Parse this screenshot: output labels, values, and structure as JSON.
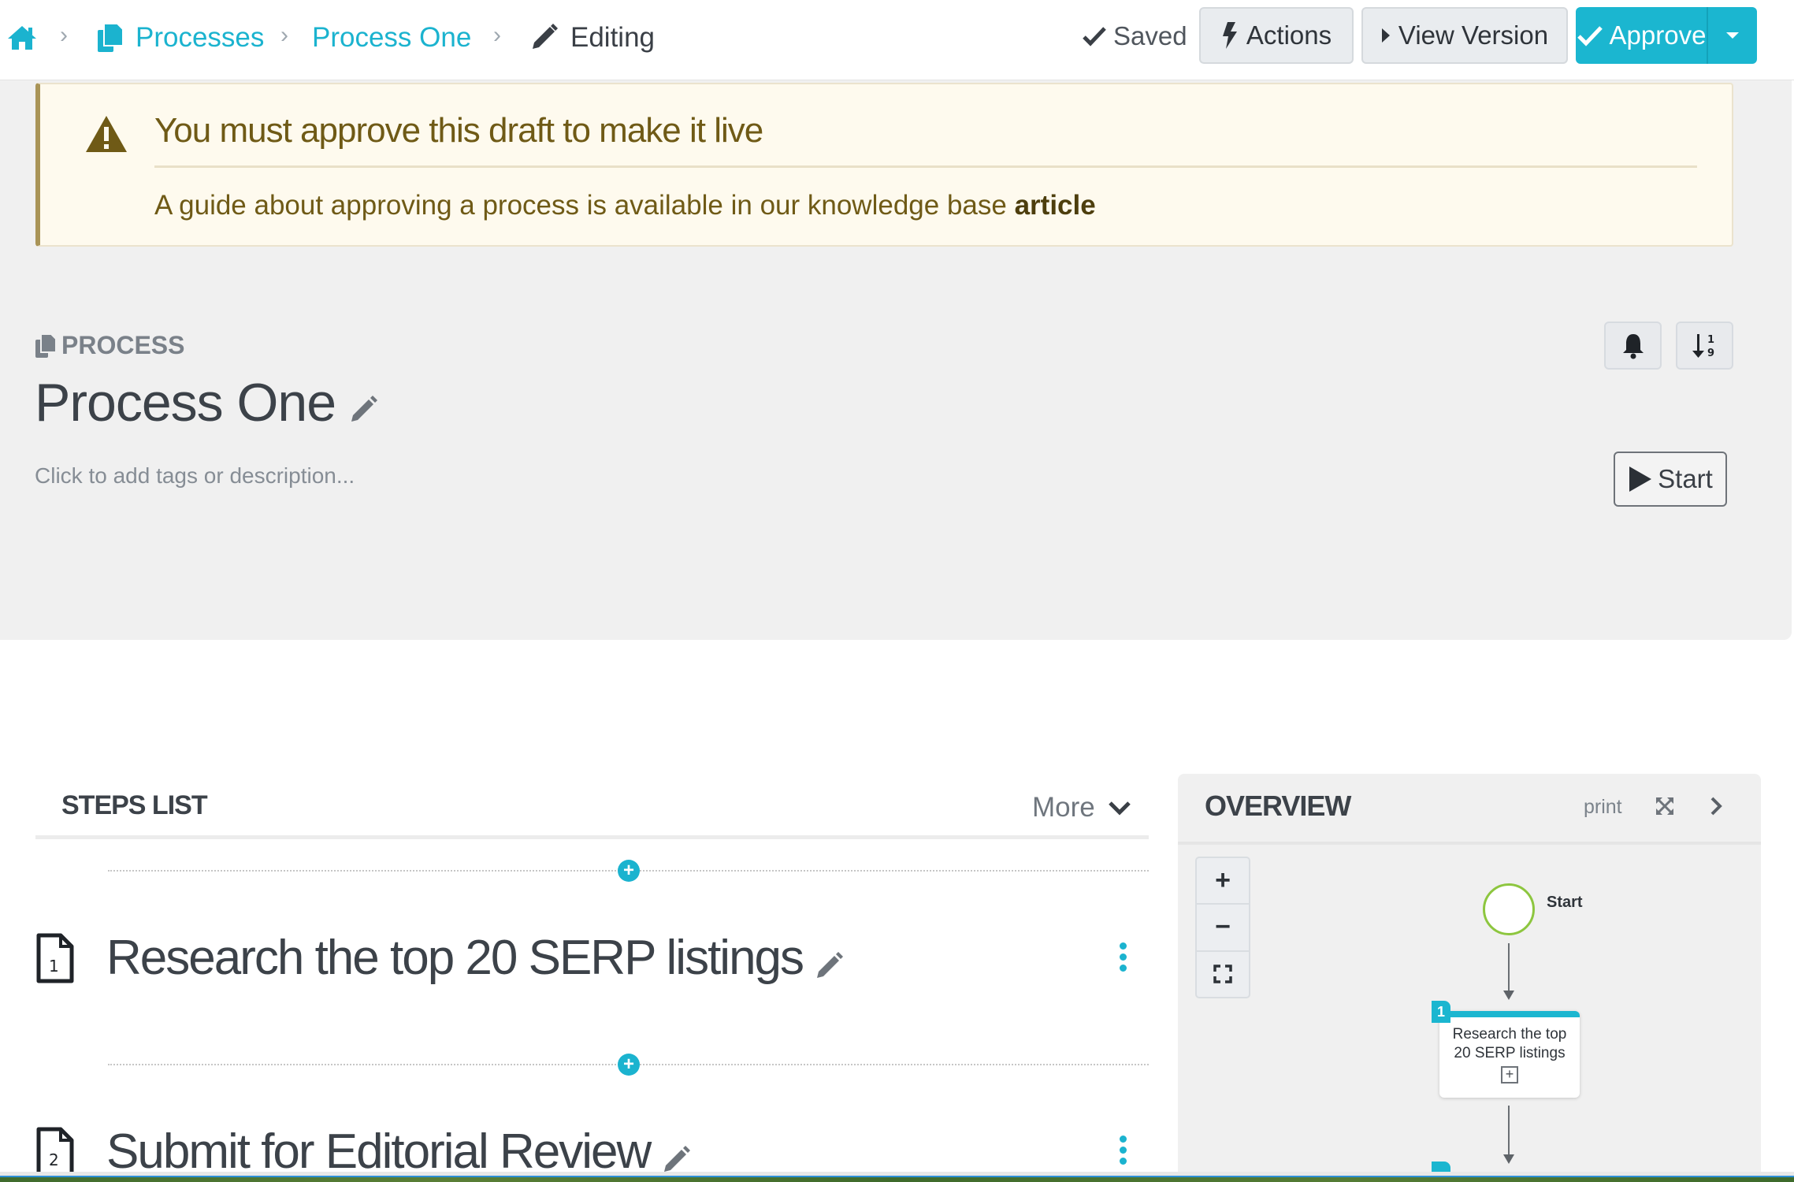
{
  "breadcrumb": {
    "home_icon": "home-icon",
    "items": [
      {
        "label": "Processes",
        "icon": "copy-icon"
      },
      {
        "label": "Process One"
      },
      {
        "label": "Editing",
        "icon": "pencil-icon"
      }
    ],
    "separator": "›"
  },
  "toolbar": {
    "saved_label": "Saved",
    "actions_label": "Actions",
    "view_version_label": "View Version",
    "approve_label": "Approve"
  },
  "alert": {
    "title": "You must approve this draft to make it live",
    "body_prefix": "A guide about approving a process is available in our knowledge base",
    "body_link": "article"
  },
  "process": {
    "type_label": "PROCESS",
    "title": "Process One",
    "description_placeholder": "Click to add tags or description...",
    "start_label": "Start"
  },
  "steps_list": {
    "title": "STEPS LIST",
    "more_label": "More",
    "steps": [
      {
        "number": "1",
        "title": "Research the top 20 SERP listings"
      },
      {
        "number": "2",
        "title": "Submit for Editorial Review"
      }
    ]
  },
  "overview": {
    "title": "OVERVIEW",
    "print_label": "print",
    "zoom_in": "+",
    "zoom_out": "−",
    "start_node_label": "Start",
    "task_nodes": [
      {
        "number": "1",
        "label_line1": "Research the top",
        "label_line2": "20 SERP listings",
        "expand": "+"
      }
    ]
  },
  "colors": {
    "accent": "#1bb3cf",
    "warning_text": "#6f5a16",
    "warning_bg": "#fefaee",
    "start_node": "#8dc63f"
  }
}
